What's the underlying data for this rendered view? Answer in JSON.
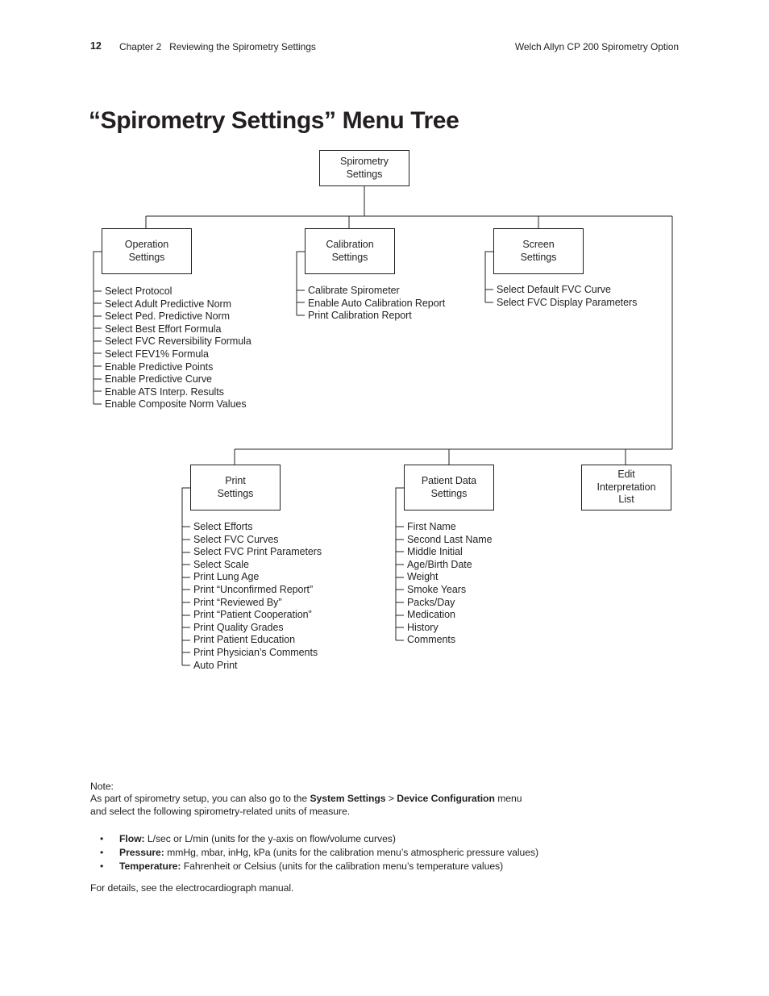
{
  "header": {
    "page_number": "12",
    "chapter": "Chapter 2   Reviewing the Spirometry Settings",
    "product": "Welch Allyn CP 200 Spirometry Option"
  },
  "title": "“Spirometry Settings” Menu Tree",
  "tree": {
    "root": {
      "line1": "Spirometry",
      "line2": "Settings"
    },
    "branches": [
      {
        "id": "operation-settings",
        "line1": "Operation",
        "line2": "Settings",
        "leaves": [
          "Select Protocol",
          "Select Adult Predictive Norm",
          "Select Ped. Predictive Norm",
          "Select Best Effort Formula",
          "Select FVC Reversibility Formula",
          "Select FEV1% Formula",
          "Enable Predictive Points",
          "Enable Predictive Curve",
          "Enable ATS Interp. Results",
          "Enable Composite Norm Values"
        ]
      },
      {
        "id": "calibration-settings",
        "line1": "Calibration",
        "line2": "Settings",
        "leaves": [
          "Calibrate Spirometer",
          "Enable Auto Calibration Report",
          "Print Calibration Report"
        ]
      },
      {
        "id": "screen-settings",
        "line1": "Screen",
        "line2": "Settings",
        "leaves": [
          "Select Default FVC Curve",
          "Select FVC Display Parameters"
        ]
      },
      {
        "id": "print-settings",
        "line1": "Print",
        "line2": "Settings",
        "leaves": [
          "Select Efforts",
          "Select FVC Curves",
          "Select FVC Print Parameters",
          "Select Scale",
          "Print Lung Age",
          "Print “Unconfirmed Report”",
          "Print “Reviewed By”",
          "Print “Patient Cooperation”",
          "Print Quality Grades",
          "Print Patient Education",
          "Print Physician’s Comments",
          "Auto Print"
        ]
      },
      {
        "id": "patient-data-settings",
        "line1": "Patient Data",
        "line2": "Settings",
        "leaves": [
          "First Name",
          "Second Last Name",
          "Middle Initial",
          "Age/Birth Date",
          "Weight",
          "Smoke Years",
          "Packs/Day",
          "Medication",
          "History",
          "Comments"
        ]
      },
      {
        "id": "edit-interpretation-list",
        "line1": "Edit",
        "line2": "Interpretation",
        "line3": "List",
        "leaves": []
      }
    ]
  },
  "note": {
    "label": "Note:",
    "body_part1": "As part of spirometry setup, you can also go to the ",
    "bold1": "System Settings",
    "separator": " > ",
    "bold2": "Device Configuration",
    "body_part2": " menu",
    "body_line2": "and select the following spirometry-related units of measure."
  },
  "bullets": [
    {
      "marker": "•",
      "term": "Flow:",
      "text": " L/sec or L/min (units for the y-axis on flow/volume curves)"
    },
    {
      "marker": "•",
      "term": "Pressure:",
      "text": " mmHg, mbar, inHg, kPa (units for the calibration menu’s atmospheric pressure values)"
    },
    {
      "marker": "•",
      "term": "Temperature:",
      "text": " Fahrenheit or Celsius (units for the calibration menu’s temperature values)"
    }
  ],
  "closing": "For details, see the electrocardiograph manual."
}
